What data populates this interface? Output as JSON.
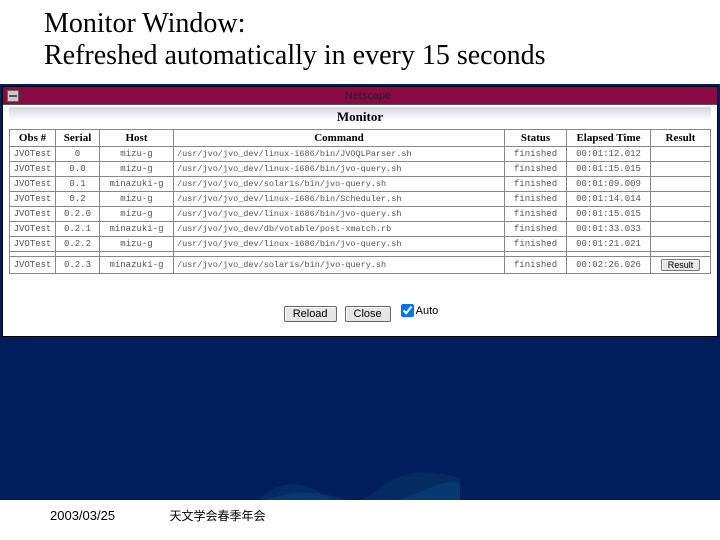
{
  "slide": {
    "title_l1": "Monitor Window:",
    "title_l2": "Refreshed automatically in every 15 seconds",
    "footer_date": "2003/03/25",
    "footer_org": "天文学会春季年会"
  },
  "window": {
    "titlebar": "Netscape",
    "heading": "Monitor",
    "columns": {
      "obs": "Obs #",
      "serial": "Serial",
      "host": "Host",
      "command": "Command",
      "status": "Status",
      "elapsed": "Elapsed Time",
      "result": "Result"
    },
    "rows": [
      {
        "obs": "JVOTest",
        "serial": "0",
        "host": "mizu-g",
        "command": "/usr/jvo/jvo_dev/linux-i686/bin/JVOQLParser.sh",
        "status": "finished",
        "elapsed": "00:01:12.012",
        "result": ""
      },
      {
        "obs": "JVOTest",
        "serial": "0.0",
        "host": "mizu-g",
        "command": "/usr/jvo/jvo_dev/linux-i686/bin/jvo-query.sh",
        "status": "finished",
        "elapsed": "00:01:15.015",
        "result": ""
      },
      {
        "obs": "JVOTest",
        "serial": "0.1",
        "host": "minazuki-g",
        "command": "/usr/jvo/jvo_dev/solaris/bin/jvo-query.sh",
        "status": "finished",
        "elapsed": "00:01:09.009",
        "result": ""
      },
      {
        "obs": "JVOTest",
        "serial": "0.2",
        "host": "mizu-g",
        "command": "/usr/jvo/jvo_dev/linux-i686/bin/Scheduler.sh",
        "status": "finished",
        "elapsed": "00:01:14.014",
        "result": ""
      },
      {
        "obs": "JVOTest",
        "serial": "0.2.0",
        "host": "mizu-g",
        "command": "/usr/jvo/jvo_dev/linux-i686/bin/jvo-query.sh",
        "status": "finished",
        "elapsed": "00:01:15.015",
        "result": ""
      },
      {
        "obs": "JVOTest",
        "serial": "0.2.1",
        "host": "minazuki-g",
        "command": "/usr/jvo/jvo_dev/db/votable/post-xmatch.rb",
        "status": "finished",
        "elapsed": "00:01:33.033",
        "result": ""
      },
      {
        "obs": "JVOTest",
        "serial": "0.2.2",
        "host": "mizu-g",
        "command": "/usr/jvo/jvo_dev/linux-i686/bin/jvo-query.sh",
        "status": "finished",
        "elapsed": "00:01:21.021",
        "result": ""
      },
      {
        "obs": "JVOTest",
        "serial": "0.2.3",
        "host": "minazuki-g",
        "command": "/usr/jvo/jvo_dev/solaris/bin/jvo-query.sh",
        "status": "finished",
        "elapsed": "00:02:26.026",
        "result": "Result"
      }
    ],
    "controls": {
      "reload": "Reload",
      "close": "Close",
      "auto_label": "Auto",
      "auto_checked": true
    }
  }
}
